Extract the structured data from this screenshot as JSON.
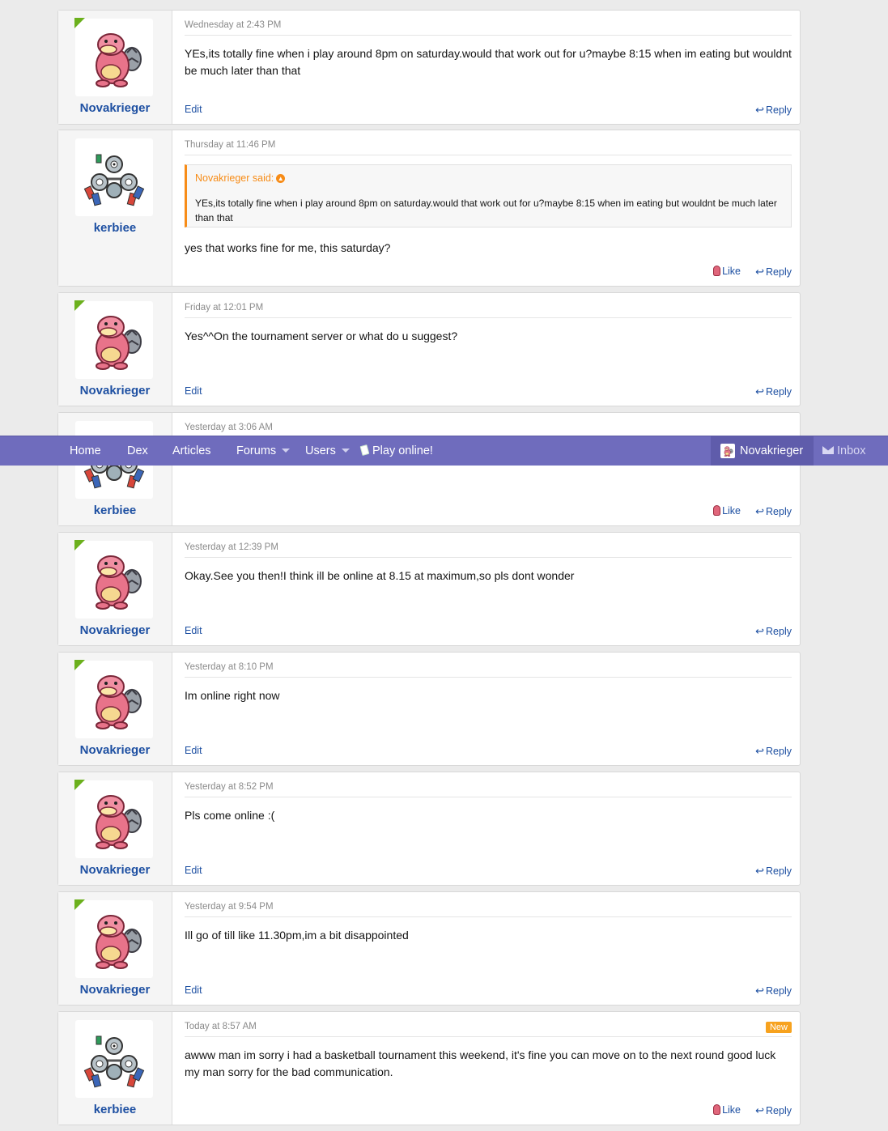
{
  "navbar": {
    "items": [
      "Home",
      "Dex",
      "Articles",
      "Forums",
      "Users",
      "Play online!"
    ],
    "user": "Novakrieger",
    "inbox": "Inbox"
  },
  "labels": {
    "edit": "Edit",
    "reply": "Reply",
    "like": "Like",
    "new": "New"
  },
  "messages": [
    {
      "author": "Novakrieger",
      "date": "Wednesday at 2:43 PM",
      "text": "YEs,its totally fine when i play around 8pm on saturday.would that work out for u?maybe 8:15 when im eating but wouldnt be much later than that"
    },
    {
      "author": "kerbiee",
      "date": "Thursday at 11:46 PM",
      "quote_author": "Novakrieger said:",
      "quote_text": "YEs,its totally fine when i play around 8pm on saturday.would that work out for u?maybe 8:15 when im eating but wouldnt be much later than that",
      "text": "yes that works fine for me, this saturday?"
    },
    {
      "author": "Novakrieger",
      "date": "Friday at 12:01 PM",
      "text": "Yes^^On the tournament server or what do u suggest?"
    },
    {
      "author": "kerbiee",
      "date": "Yesterday at 3:06 AM",
      "text": ""
    },
    {
      "author": "Novakrieger",
      "date": "Yesterday at 12:39 PM",
      "text": "Okay.See you then!I think ill be online at 8.15 at maximum,so pls dont wonder"
    },
    {
      "author": "Novakrieger",
      "date": "Yesterday at 8:10 PM",
      "text": "Im online right now"
    },
    {
      "author": "Novakrieger",
      "date": "Yesterday at 8:52 PM",
      "text": "Pls come online :("
    },
    {
      "author": "Novakrieger",
      "date": "Yesterday at 9:54 PM",
      "text": "Ill go of till like 11.30pm,im a bit disappointed"
    },
    {
      "author": "kerbiee",
      "date": "Today at 8:57 AM",
      "text": "awww man im sorry i had a basketball tournament this weekend, it's fine you can move on to the next round good luck my man sorry for the bad communication."
    }
  ]
}
